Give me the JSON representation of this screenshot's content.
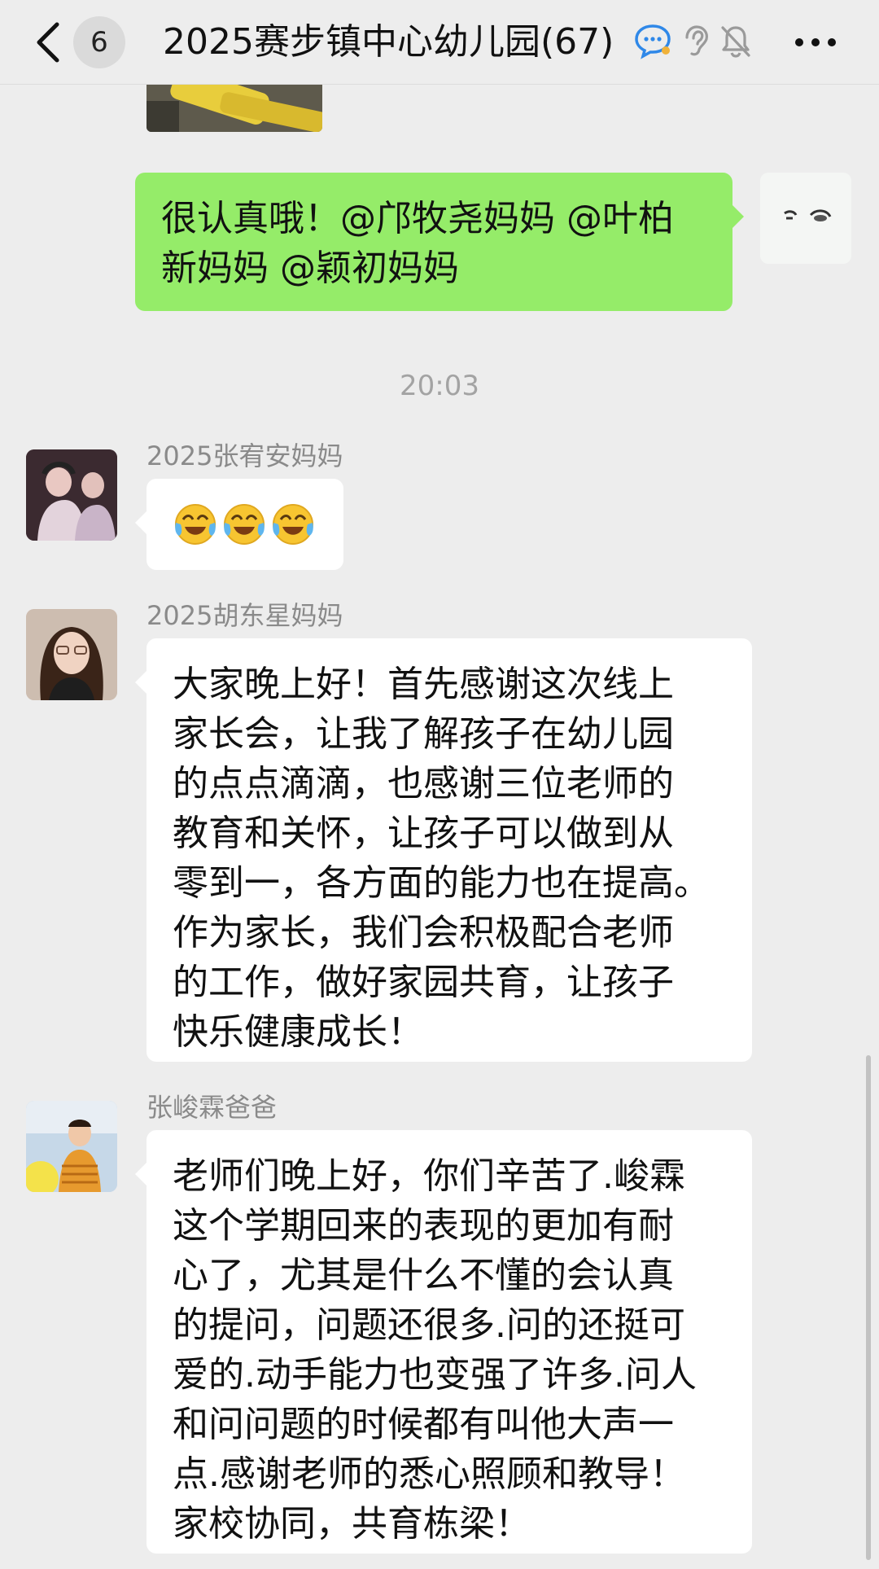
{
  "header": {
    "unread_count": "6",
    "title": "2025赛步镇中心幼儿园(67)",
    "icons": [
      "chevron-left-icon",
      "chat-bubble-icon",
      "ear-icon",
      "muted-bell-icon",
      "more-dots-icon"
    ]
  },
  "messages": [
    {
      "type": "image",
      "from": "me",
      "note": "image-preview"
    },
    {
      "type": "text",
      "from": "me",
      "text": "很认真哦！@邝牧尧妈妈 @叶柏\n新妈妈 @颖初妈妈"
    },
    {
      "type": "time",
      "text": "20:03"
    },
    {
      "type": "emoji",
      "from": "other",
      "sender": "2025张宥安妈妈",
      "emojis": [
        "tears-of-joy-emoji",
        "tears-of-joy-emoji",
        "tears-of-joy-emoji"
      ]
    },
    {
      "type": "text",
      "from": "other",
      "sender": "2025胡东星妈妈",
      "text": "大家晚上好！首先感谢这次线上\n家长会，让我了解孩子在幼儿园\n的点点滴滴，也感谢三位老师的\n教育和关怀，让孩子可以做到从\n零到一，各方面的能力也在提高。\n作为家长，我们会积极配合老师\n的工作，做好家园共育，让孩子\n快乐健康成长！"
    },
    {
      "type": "text",
      "from": "other",
      "sender": "张峻霖爸爸",
      "text": "老师们晚上好，你们辛苦了.峻霖\n这个学期回来的表现的更加有耐\n心了，尤其是什么不懂的会认真\n的提问，问题还很多.问的还挺可\n爱的.动手能力也变强了许多.问人\n和问问题的时候都有叫他大声一\n点.感谢老师的悉心照顾和教导！\n家校协同，共育栋梁！"
    }
  ],
  "colors": {
    "background": "#ededed",
    "my_bubble": "#95ec69",
    "other_bubble": "#ffffff",
    "name_text": "#8a8a8a",
    "time_text": "#a3a3a3"
  }
}
